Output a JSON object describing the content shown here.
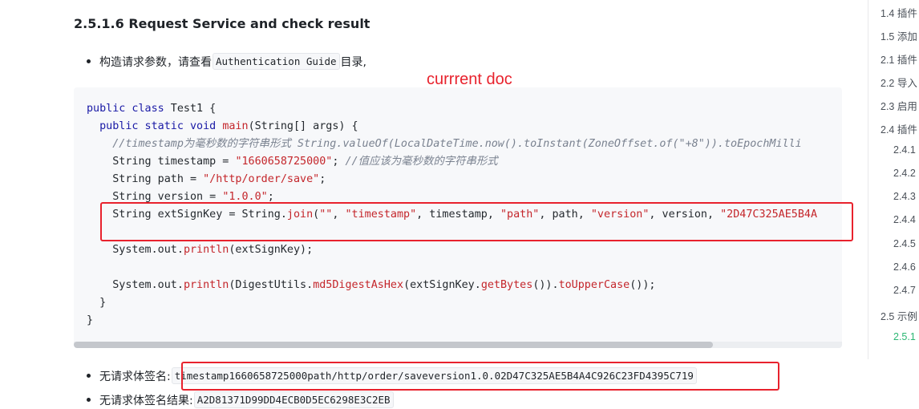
{
  "heading": "2.5.1.6 Request Service and check result",
  "bullet1": {
    "prefix": "构造请求参数，请查看",
    "code": "Authentication Guide",
    "suffix": "目录,"
  },
  "annotation": "currrent doc",
  "code": {
    "l1": {
      "a": "public class",
      "b": " Test1 {"
    },
    "l2": {
      "a": "  public static void ",
      "b": "main",
      "c": "(String[] args) {"
    },
    "l3": {
      "a": "    //timestamp为毫秒数的字符串形式 String.valueOf(LocalDateTime.now().toInstant(ZoneOffset.of(\"+8\")).toEpochMilli"
    },
    "l4": {
      "a": "    String timestamp = ",
      "b": "\"1660658725000\"",
      "c": "; ",
      "d": "//值应该为毫秒数的字符串形式"
    },
    "l5": {
      "a": "    String path = ",
      "b": "\"/http/order/save\"",
      "c": ";"
    },
    "l6": {
      "a": "    String version = ",
      "b": "\"1.0.0\"",
      "c": ";"
    },
    "l7": {
      "a": "    String extSignKey = String.",
      "b": "join",
      "c": "(",
      "d": "\"\"",
      "e": ", ",
      "f": "\"timestamp\"",
      "g": ", timestamp, ",
      "h": "\"path\"",
      "i": ", path, ",
      "j": "\"version\"",
      "k": ", version, ",
      "l": "\"2D47C325AE5B4A"
    },
    "l8": {
      "a": "    System.out.",
      "b": "println",
      "c": "(extSignKey);"
    },
    "l9": {
      "a": "    System.out.",
      "b": "println",
      "c": "(DigestUtils.",
      "d": "md5DigestAsHex",
      "e": "(extSignKey.",
      "f": "getBytes",
      "g": "()).",
      "h": "toUpperCase",
      "i": "());"
    },
    "l10": {
      "a": "  }"
    },
    "l11": {
      "a": "}"
    }
  },
  "bullet2": {
    "label": "无请求体签名:",
    "code": "timestamp1660658725000path/http/order/saveversion1.0.02D47C325AE5B4A4C926C23FD4395C719"
  },
  "bullet3": {
    "label": "无请求体签名结果:",
    "code": "A2D81371D99DD4ECB0D5EC6298E3C2EB"
  },
  "toc": [
    {
      "label": "1.4 插件"
    },
    {
      "label": "1.5 添加"
    },
    {
      "label": "2.1 插件"
    },
    {
      "label": "2.2 导入"
    },
    {
      "label": "2.3 启用"
    },
    {
      "label": "2.4 插件"
    },
    {
      "label": "2.4.1"
    },
    {
      "label": "2.4.2"
    },
    {
      "label": "2.4.3"
    },
    {
      "label": "2.4.4"
    },
    {
      "label": "2.4.5"
    },
    {
      "label": "2.4.6"
    },
    {
      "label": "2.4.7"
    },
    {
      "label": "2.5 示例"
    },
    {
      "label": "2.5.1"
    }
  ],
  "colors": {
    "annotation_red": "#e8222d",
    "keyword": "#1a1aa6",
    "string": "#c4262b",
    "toc_active": "#2bb673"
  }
}
